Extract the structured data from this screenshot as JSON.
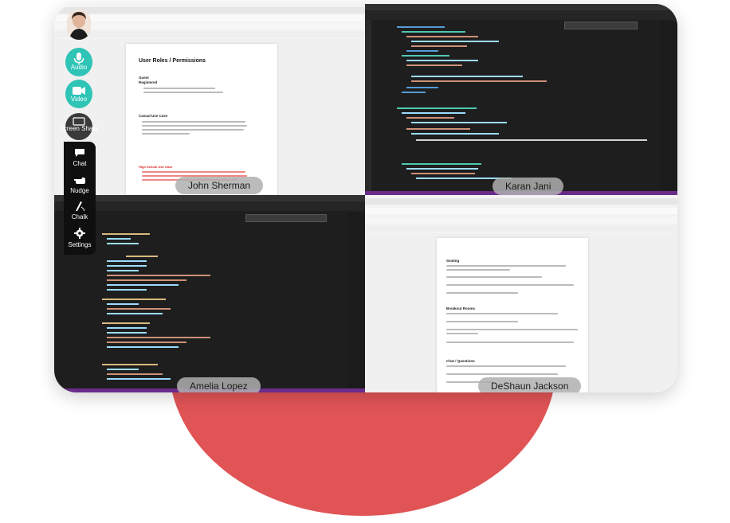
{
  "participants": [
    {
      "name": "John Sherman"
    },
    {
      "name": "Karan Jani"
    },
    {
      "name": "Amelia Lopez"
    },
    {
      "name": "DeShaun Jackson"
    }
  ],
  "controls": {
    "audio": "Audio",
    "video": "Video",
    "screen_share": "Screen Share",
    "chat": "Chat",
    "nudge": "Nudge",
    "chalk": "Chalk",
    "settings": "Settings"
  },
  "shared_doc_1": {
    "title": "User Roles / Permissions",
    "section_guest": "Guest",
    "section_registered": "Registered",
    "section_casual": "Casual Use Case",
    "section_hs": "High School Use Case"
  },
  "shared_doc_2": {
    "section_seating": "Seating",
    "section_breakout": "Breakout Rooms",
    "section_chat": "Chat / Questions"
  },
  "colors": {
    "accent_teal": "#2ec4b6",
    "backdrop_red": "#e05456",
    "editor_bg": "#1e1e1e",
    "statusbar_purple": "#6a2c8a"
  }
}
